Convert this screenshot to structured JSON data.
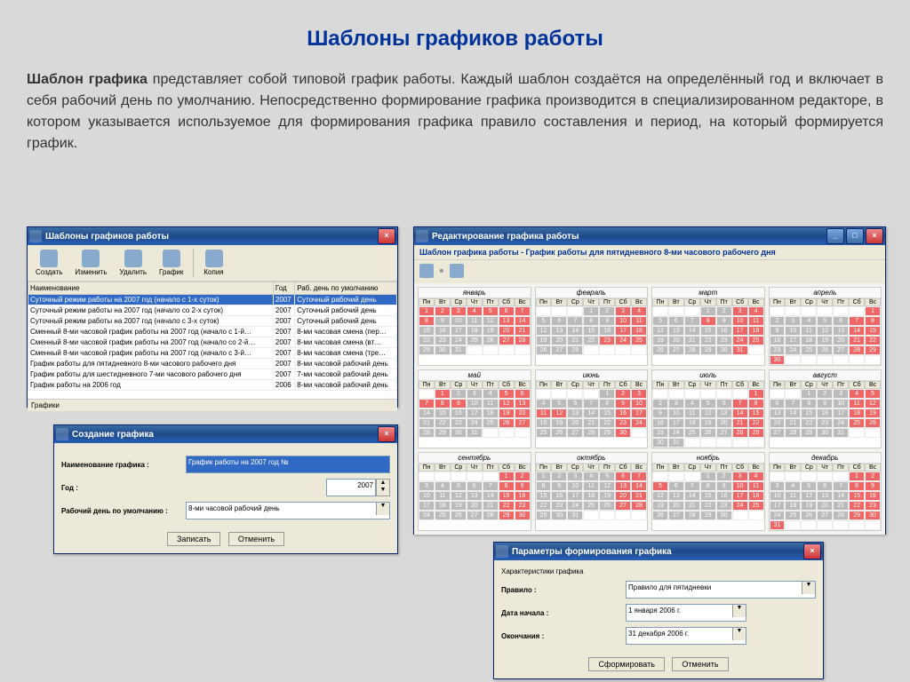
{
  "page": {
    "title": "Шаблоны графиков работы",
    "desc_bold": "Шаблон графика",
    "desc_rest": " представляет собой типовой график работы. Каждый шаблон создаётся на определённый год и включает в себя рабочий день по умолчанию. Непосредственно формирование графика производится в специализированном редакторе, в котором указывается используемое для формирования графика правило составления и период, на который формируется график."
  },
  "win1": {
    "title": "Шаблоны графиков работы",
    "toolbar": [
      "Создать",
      "Изменить",
      "Удалить",
      "График",
      "Копия"
    ],
    "columns": [
      "Наименование",
      "Год",
      "Раб. день по умолчанию"
    ],
    "rows": [
      [
        "Суточный режим работы на 2007 год (начало с 1-х суток)",
        "2007",
        "Суточный рабочий день"
      ],
      [
        "Суточный режим работы на 2007 год (начало со 2-х суток)",
        "2007",
        "Суточный рабочий день"
      ],
      [
        "Суточный режим работы на 2007 год (начало с 3-х суток)",
        "2007",
        "Суточный рабочий день"
      ],
      [
        "Сменный 8-ми часовой график работы на 2007 год (начало с 1-й…",
        "2007",
        "8-ми часовая смена (пер…"
      ],
      [
        "Сменный 8-ми часовой график работы на 2007 год (начало со 2-й…",
        "2007",
        "8-ми часовая смена (вт…"
      ],
      [
        "Сменный 8-ми часовой график работы на 2007 год (начало с 3-й…",
        "2007",
        "8-ми часовая смена (тре…"
      ],
      [
        "График работы для пятидневного 8-ми часового рабочего дня",
        "2007",
        "8-ми часовой рабочий день"
      ],
      [
        "График работы для шестидневного 7-ми часового рабочего дня",
        "2007",
        "7-ми часовой рабочий день"
      ],
      [
        "График работы на 2006 год",
        "2006",
        "8-ми часовой рабочий день"
      ]
    ],
    "status": "Графики"
  },
  "win2": {
    "title": "Создание графика",
    "lbl_name": "Наименование графика :",
    "val_name": "График работы на 2007 год №",
    "lbl_year": "Год :",
    "val_year": "2007",
    "lbl_day": "Рабочий день по умолчанию :",
    "val_day": "8-ми часовой рабочий день",
    "btn_save": "Записать",
    "btn_cancel": "Отменить"
  },
  "win3": {
    "title": "Редактирование графика работы",
    "subtitle": "Шаблон графика работы - График работы для пятидневного 8-ми часового рабочего дня",
    "days": [
      "Пн",
      "Вт",
      "Ср",
      "Чт",
      "Пт",
      "Сб",
      "Вс"
    ],
    "months": [
      {
        "name": "январь",
        "offset": 0,
        "red": [
          1,
          2,
          3,
          4,
          5,
          6,
          7,
          8,
          13,
          14,
          20,
          21,
          27,
          28
        ]
      },
      {
        "name": "февраль",
        "offset": 3,
        "red": [
          3,
          4,
          10,
          11,
          17,
          18,
          23,
          24,
          25
        ]
      },
      {
        "name": "март",
        "offset": 3,
        "red": [
          3,
          4,
          8,
          10,
          11,
          17,
          18,
          24,
          25,
          31
        ]
      },
      {
        "name": "апрель",
        "offset": 6,
        "red": [
          1,
          7,
          8,
          14,
          15,
          21,
          22,
          28,
          29,
          30
        ]
      },
      {
        "name": "май",
        "offset": 1,
        "red": [
          1,
          5,
          6,
          7,
          8,
          9,
          12,
          13,
          19,
          20,
          26,
          27
        ]
      },
      {
        "name": "июнь",
        "offset": 4,
        "red": [
          2,
          3,
          9,
          10,
          11,
          12,
          16,
          17,
          23,
          24,
          30
        ]
      },
      {
        "name": "июль",
        "offset": 6,
        "red": [
          1,
          7,
          8,
          14,
          15,
          21,
          22,
          28,
          29
        ]
      },
      {
        "name": "август",
        "offset": 2,
        "red": [
          4,
          5,
          11,
          12,
          18,
          19,
          25,
          26
        ]
      },
      {
        "name": "сентябрь",
        "offset": 5,
        "red": [
          1,
          2,
          8,
          9,
          15,
          16,
          22,
          23,
          29,
          30
        ]
      },
      {
        "name": "октябрь",
        "offset": 0,
        "red": [
          6,
          7,
          13,
          14,
          20,
          21,
          27,
          28
        ]
      },
      {
        "name": "ноябрь",
        "offset": 3,
        "red": [
          3,
          4,
          5,
          10,
          11,
          17,
          18,
          24,
          25
        ]
      },
      {
        "name": "декабрь",
        "offset": 5,
        "red": [
          1,
          2,
          8,
          9,
          15,
          16,
          22,
          23,
          29,
          30,
          31
        ]
      }
    ]
  },
  "win4": {
    "title": "Параметры формирования графика",
    "section": "Характеристики графика",
    "lbl_rule": "Правило :",
    "val_rule": "Правило для пятидневки",
    "lbl_start": "Дата начала :",
    "val_start": "1 января 2006 г.",
    "lbl_end": "Окончания :",
    "val_end": "31 декабря 2006 г.",
    "btn_form": "Сформировать",
    "btn_cancel": "Отменить"
  }
}
